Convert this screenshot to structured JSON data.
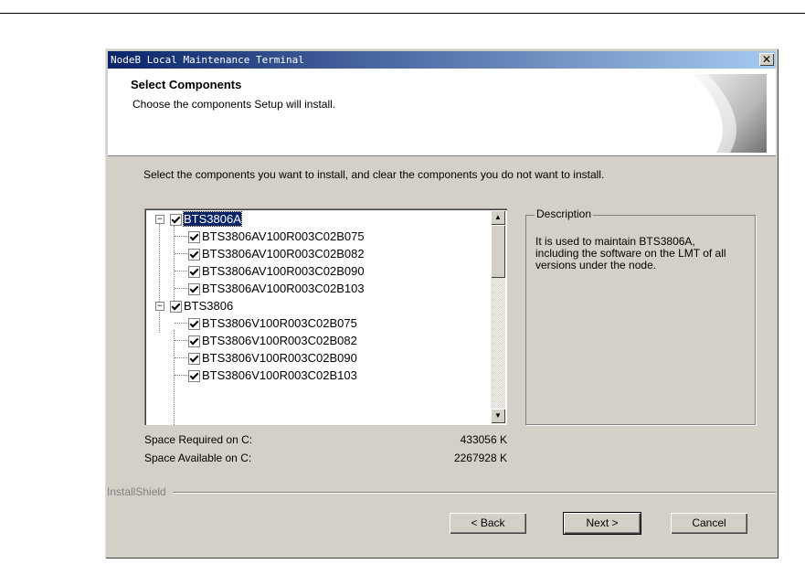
{
  "window": {
    "title": "NodeB Local Maintenance Terminal",
    "close_icon": "close-icon"
  },
  "header": {
    "title": "Select Components",
    "subtitle": "Choose the components Setup will install."
  },
  "instruction": "Select the components you want to install, and clear the components you do not want to install.",
  "tree": {
    "items": [
      {
        "label": "BTS3806A",
        "level": 0,
        "checked": true,
        "expander": "−",
        "selected": true
      },
      {
        "label": "BTS3806AV100R003C02B075",
        "level": 1,
        "checked": true
      },
      {
        "label": "BTS3806AV100R003C02B082",
        "level": 1,
        "checked": true
      },
      {
        "label": "BTS3806AV100R003C02B090",
        "level": 1,
        "checked": true
      },
      {
        "label": "BTS3806AV100R003C02B103",
        "level": 1,
        "checked": true
      },
      {
        "label": "BTS3806",
        "level": 0,
        "checked": true,
        "expander": "−"
      },
      {
        "label": "BTS3806V100R003C02B075",
        "level": 1,
        "checked": true
      },
      {
        "label": "BTS3806V100R003C02B082",
        "level": 1,
        "checked": true
      },
      {
        "label": "BTS3806V100R003C02B090",
        "level": 1,
        "checked": true
      },
      {
        "label": "BTS3806V100R003C02B103",
        "level": 1,
        "checked": true
      }
    ]
  },
  "description": {
    "label": "Description",
    "text": "It is used to maintain BTS3806A, including the software on the LMT of all versions under the node."
  },
  "space": {
    "required_label": "Space Required on  C:",
    "required_value": "433056 K",
    "available_label": "Space Available on  C:",
    "available_value": "2267928 K"
  },
  "brand": "InstallShield",
  "buttons": {
    "back": "< Back",
    "next": "Next >",
    "cancel": "Cancel"
  }
}
